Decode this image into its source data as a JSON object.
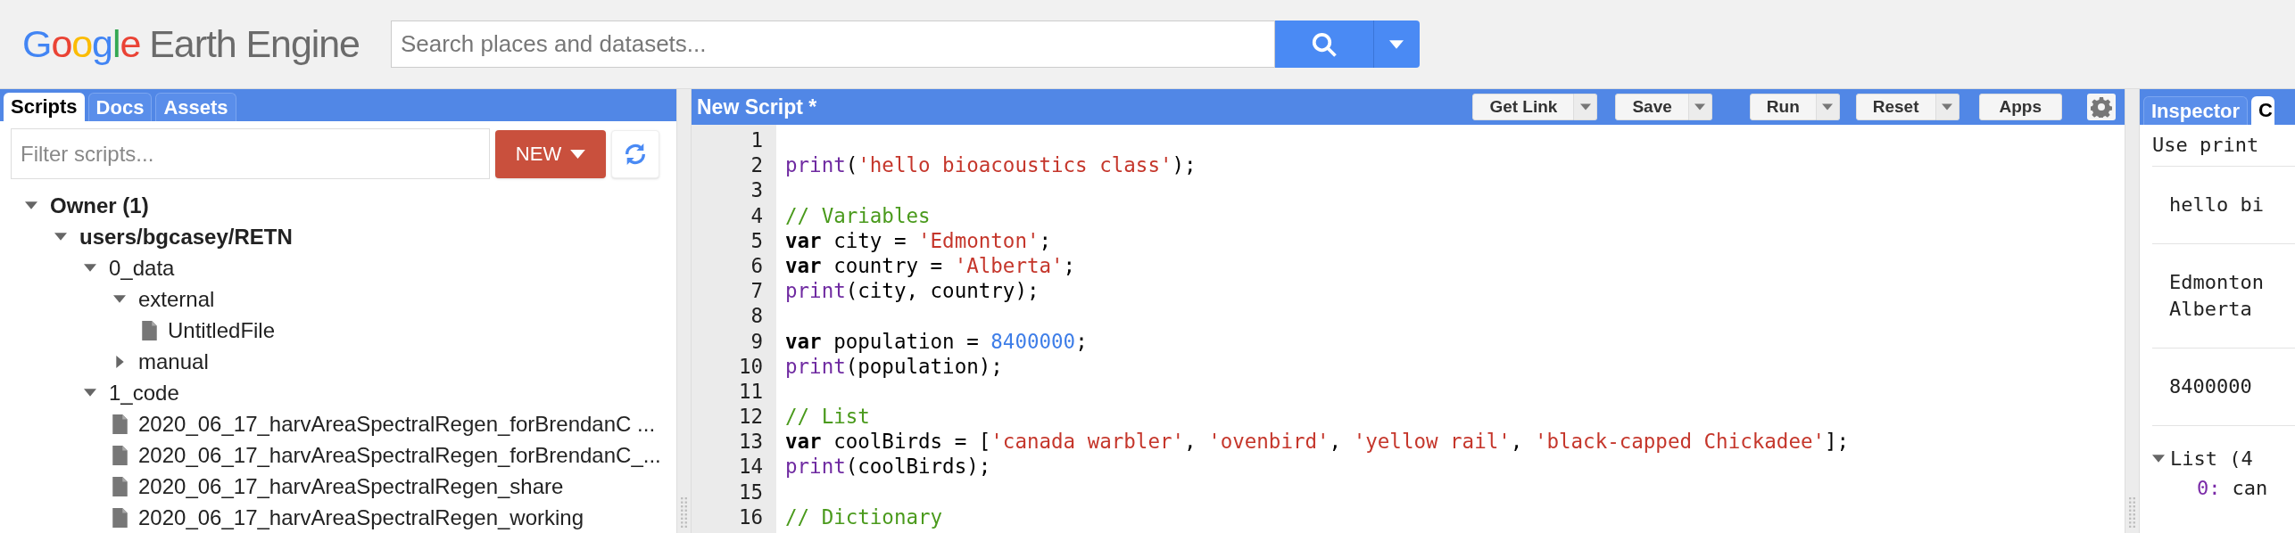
{
  "header": {
    "logo": {
      "brand": "Google",
      "product": "Earth Engine"
    },
    "search": {
      "placeholder": "Search places and datasets..."
    }
  },
  "left_panel": {
    "tabs": [
      {
        "label": "Scripts",
        "selected": true
      },
      {
        "label": "Docs",
        "selected": false
      },
      {
        "label": "Assets",
        "selected": false
      }
    ],
    "filter": {
      "placeholder": "Filter scripts..."
    },
    "new_button": "NEW",
    "tree": [
      {
        "label": "Owner (1)",
        "kind": "group",
        "expanded": true,
        "children": [
          {
            "label": "users/bgcasey/RETN",
            "kind": "repo",
            "expanded": true,
            "children": [
              {
                "label": "0_data",
                "kind": "folder",
                "expanded": true,
                "children": [
                  {
                    "label": "external",
                    "kind": "folder",
                    "expanded": true,
                    "children": [
                      {
                        "label": "UntitledFile",
                        "kind": "file"
                      }
                    ]
                  },
                  {
                    "label": "manual",
                    "kind": "folder",
                    "expanded": false
                  }
                ]
              },
              {
                "label": "1_code",
                "kind": "folder",
                "expanded": true,
                "children": [
                  {
                    "label": "2020_06_17_harvAreaSpectralRegen_forBrendanC ...",
                    "kind": "file"
                  },
                  {
                    "label": "2020_06_17_harvAreaSpectralRegen_forBrendanC_...",
                    "kind": "file"
                  },
                  {
                    "label": "2020_06_17_harvAreaSpectralRegen_share",
                    "kind": "file"
                  },
                  {
                    "label": "2020_06_17_harvAreaSpectralRegen_working",
                    "kind": "file"
                  }
                ]
              }
            ]
          }
        ]
      }
    ]
  },
  "editor": {
    "title": "New Script *",
    "buttons": [
      {
        "label": "Get Link",
        "dropdown": true
      },
      {
        "label": "Save",
        "dropdown": true
      },
      {
        "label": "Run",
        "dropdown": true
      },
      {
        "label": "Reset",
        "dropdown": true
      },
      {
        "label": "Apps",
        "dropdown": false
      }
    ],
    "lines": [
      {
        "number": "1"
      },
      {
        "number": "2",
        "tokens": [
          {
            "kind": "func",
            "text": "print"
          },
          {
            "kind": "plain",
            "text": "("
          },
          {
            "kind": "string",
            "text": "'hello bioacoustics class'"
          },
          {
            "kind": "plain",
            "text": ");"
          }
        ]
      },
      {
        "number": "3"
      },
      {
        "number": "4",
        "tokens": [
          {
            "kind": "comment",
            "text": "// Variables"
          }
        ]
      },
      {
        "number": "5",
        "tokens": [
          {
            "kind": "keyword",
            "text": "var"
          },
          {
            "kind": "plain",
            "text": " city = "
          },
          {
            "kind": "string",
            "text": "'Edmonton'"
          },
          {
            "kind": "plain",
            "text": ";"
          }
        ]
      },
      {
        "number": "6",
        "tokens": [
          {
            "kind": "keyword",
            "text": "var"
          },
          {
            "kind": "plain",
            "text": " country = "
          },
          {
            "kind": "string",
            "text": "'Alberta'"
          },
          {
            "kind": "plain",
            "text": ";"
          }
        ]
      },
      {
        "number": "7",
        "tokens": [
          {
            "kind": "func",
            "text": "print"
          },
          {
            "kind": "plain",
            "text": "(city, country);"
          }
        ]
      },
      {
        "number": "8"
      },
      {
        "number": "9",
        "tokens": [
          {
            "kind": "keyword",
            "text": "var"
          },
          {
            "kind": "plain",
            "text": " population = "
          },
          {
            "kind": "number",
            "text": "8400000"
          },
          {
            "kind": "plain",
            "text": ";"
          }
        ]
      },
      {
        "number": "10",
        "tokens": [
          {
            "kind": "func",
            "text": "print"
          },
          {
            "kind": "plain",
            "text": "(population);"
          }
        ]
      },
      {
        "number": "11"
      },
      {
        "number": "12",
        "tokens": [
          {
            "kind": "comment",
            "text": "// List"
          }
        ]
      },
      {
        "number": "13",
        "tokens": [
          {
            "kind": "keyword",
            "text": "var"
          },
          {
            "kind": "plain",
            "text": " coolBirds = ["
          },
          {
            "kind": "string",
            "text": "'canada warbler'"
          },
          {
            "kind": "plain",
            "text": ", "
          },
          {
            "kind": "string",
            "text": "'ovenbird'"
          },
          {
            "kind": "plain",
            "text": ", "
          },
          {
            "kind": "string",
            "text": "'yellow rail'"
          },
          {
            "kind": "plain",
            "text": ", "
          },
          {
            "kind": "string",
            "text": "'black-capped Chickadee'"
          },
          {
            "kind": "plain",
            "text": "];"
          }
        ]
      },
      {
        "number": "14",
        "tokens": [
          {
            "kind": "func",
            "text": "print"
          },
          {
            "kind": "plain",
            "text": "(coolBirds);"
          }
        ]
      },
      {
        "number": "15"
      },
      {
        "number": "16",
        "tokens": [
          {
            "kind": "comment",
            "text": "// Dictionary"
          }
        ]
      }
    ]
  },
  "right_panel": {
    "tabs": [
      {
        "label": "Inspector",
        "selected": false
      },
      {
        "label": "C",
        "selected": true
      }
    ],
    "console": [
      {
        "kind": "hint",
        "lines": [
          "Use print"
        ]
      },
      {
        "kind": "output",
        "lines": [
          "hello bi"
        ]
      },
      {
        "kind": "output",
        "lines": [
          "Edmonton",
          "Alberta"
        ]
      },
      {
        "kind": "output",
        "lines": [
          "8400000"
        ]
      },
      {
        "kind": "list",
        "label": "List (4",
        "expanded": true,
        "children": [
          {
            "index": "0:",
            "value": "can"
          }
        ]
      }
    ]
  }
}
